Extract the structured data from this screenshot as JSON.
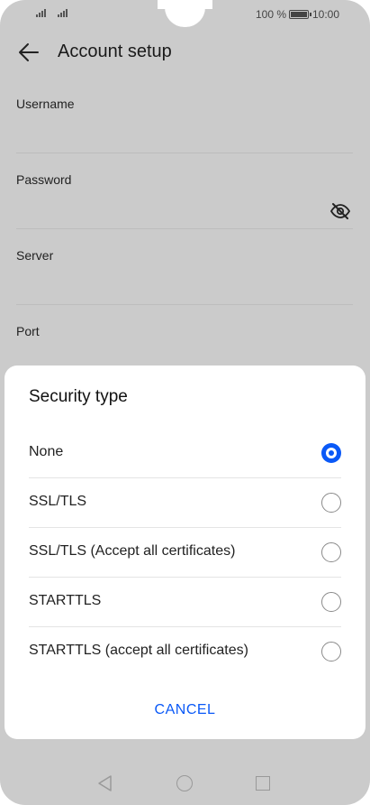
{
  "status_bar": {
    "battery_percent": "100 %",
    "time": "10:00"
  },
  "app_bar": {
    "title": "Account setup",
    "back_icon": "arrow-left-icon"
  },
  "form": {
    "fields": [
      {
        "label": "Username",
        "value": ""
      },
      {
        "label": "Password",
        "value": "",
        "toggle_icon": "eye-off-icon"
      },
      {
        "label": "Server",
        "value": ""
      },
      {
        "label": "Port",
        "value": ""
      }
    ]
  },
  "dialog": {
    "title": "Security type",
    "options": [
      {
        "label": "None",
        "selected": true
      },
      {
        "label": "SSL/TLS",
        "selected": false
      },
      {
        "label": "SSL/TLS (Accept all certificates)",
        "selected": false
      },
      {
        "label": "STARTTLS",
        "selected": false
      },
      {
        "label": "STARTTLS (accept all certificates)",
        "selected": false
      }
    ],
    "cancel_label": "CANCEL"
  },
  "nav_bar": {
    "icons": [
      "triangle-back-icon",
      "circle-home-icon",
      "square-recents-icon"
    ]
  },
  "colors": {
    "accent": "#0a59f7",
    "scrim_background": "#cbcbcb",
    "dialog_background": "#ffffff"
  }
}
